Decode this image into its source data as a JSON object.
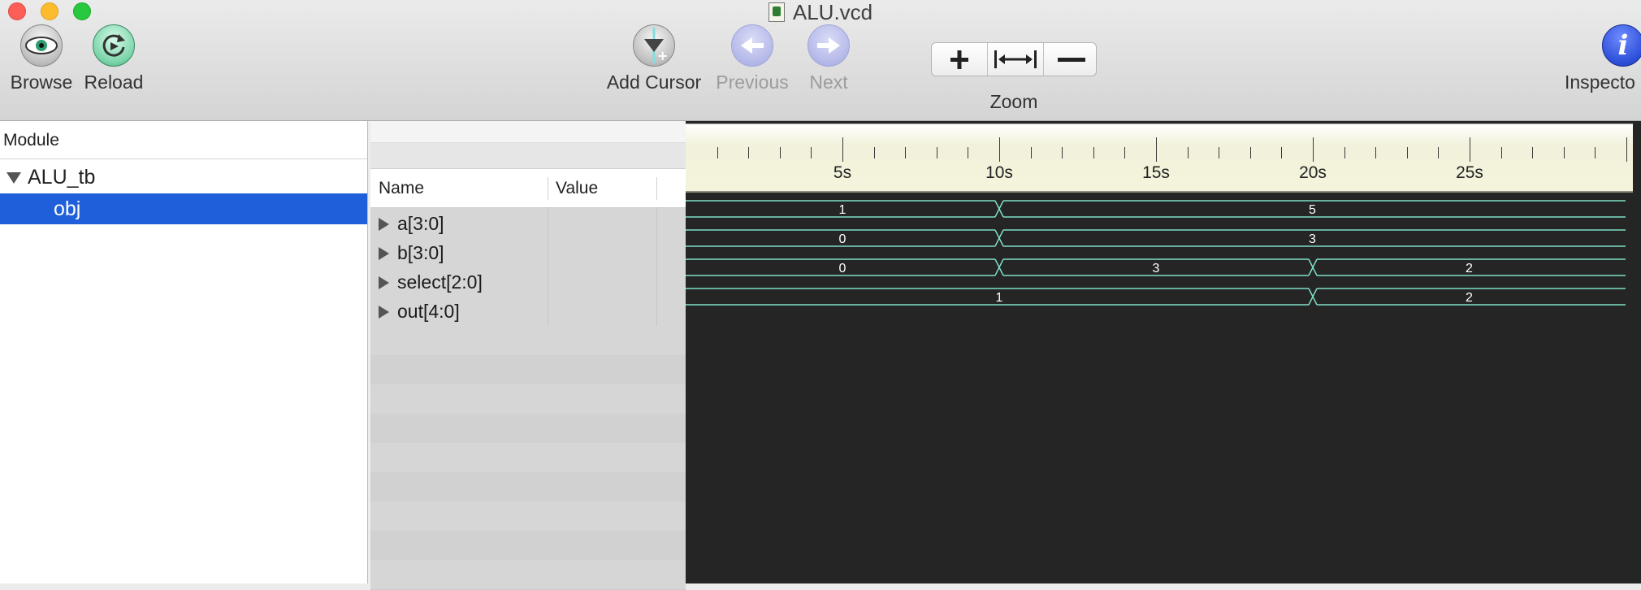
{
  "window": {
    "title": "ALU.vcd"
  },
  "toolbar": {
    "browse": "Browse",
    "reload": "Reload",
    "add_cursor": "Add Cursor",
    "previous": "Previous",
    "next": "Next",
    "zoom": "Zoom",
    "inspector": "Inspecto"
  },
  "module_panel": {
    "header": "Module",
    "items": [
      {
        "label": "ALU_tb",
        "expanded": true
      },
      {
        "label": "obj",
        "selected": true
      }
    ]
  },
  "signal_list": {
    "columns": [
      "Name",
      "Value"
    ],
    "signals": [
      {
        "name": "a[3:0]",
        "value": ""
      },
      {
        "name": "b[3:0]",
        "value": ""
      },
      {
        "name": "select[2:0]",
        "value": ""
      },
      {
        "name": "out[4:0]",
        "value": ""
      }
    ]
  },
  "timeline": {
    "tick_labels": [
      "5s",
      "10s",
      "15s",
      "20s",
      "25s"
    ]
  },
  "waveforms": [
    {
      "signal": "a[3:0]",
      "segments": [
        {
          "from": 0,
          "to": 10,
          "value": "1"
        },
        {
          "from": 10,
          "to": 30,
          "value": "5"
        }
      ]
    },
    {
      "signal": "b[3:0]",
      "segments": [
        {
          "from": 0,
          "to": 10,
          "value": "0"
        },
        {
          "from": 10,
          "to": 30,
          "value": "3"
        }
      ]
    },
    {
      "signal": "select[2:0]",
      "segments": [
        {
          "from": 0,
          "to": 10,
          "value": "0"
        },
        {
          "from": 10,
          "to": 20,
          "value": "3"
        },
        {
          "from": 20,
          "to": 30,
          "value": "2"
        }
      ]
    },
    {
      "signal": "out[4:0]",
      "segments": [
        {
          "from": 0,
          "to": 20,
          "value": "1"
        },
        {
          "from": 20,
          "to": 30,
          "value": "2"
        }
      ]
    }
  ],
  "colors": {
    "wave": "#7fe0c8",
    "selection": "#1f5fd9"
  }
}
